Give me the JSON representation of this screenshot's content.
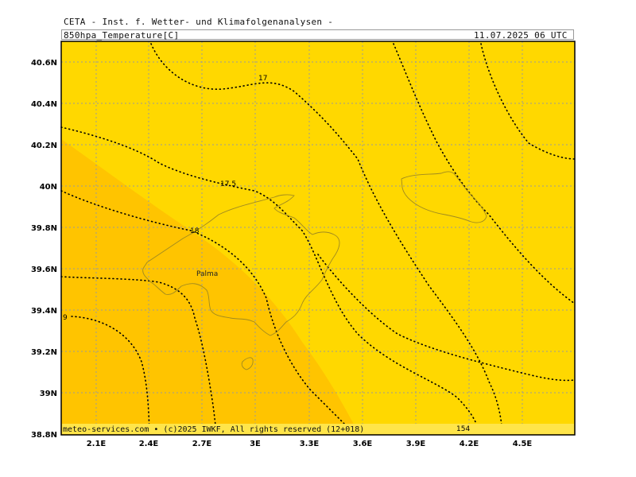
{
  "header": {
    "organization": "CETA - Inst. f. Wetter- und Klimafolgenanalysen -",
    "parameter": "850hpa_Temperature[C]",
    "valid_time": "11.07.2025 06 UTC"
  },
  "map": {
    "lon_ticks": [
      "2.1E",
      "2.4E",
      "2.7E",
      "3E",
      "3.3E",
      "3.6E",
      "3.9E",
      "4.2E",
      "4.5E"
    ],
    "lat_ticks": [
      "40.6N",
      "40.4N",
      "40.2N",
      "40N",
      "39.8N",
      "39.6N",
      "39.4N",
      "39.2N",
      "39N",
      "38.8N"
    ],
    "contour_labels": [
      "17",
      "17.5",
      "18",
      "9",
      "154"
    ],
    "place": "Palma",
    "colors": {
      "warm": "#ffc400",
      "main": "#ffd800",
      "coast": "#a08a20",
      "grid": "#9a9a9a"
    }
  },
  "footer": {
    "credit": "meteo-services.com • (c)2025 IWKF, All rights reserved (12+018)"
  }
}
